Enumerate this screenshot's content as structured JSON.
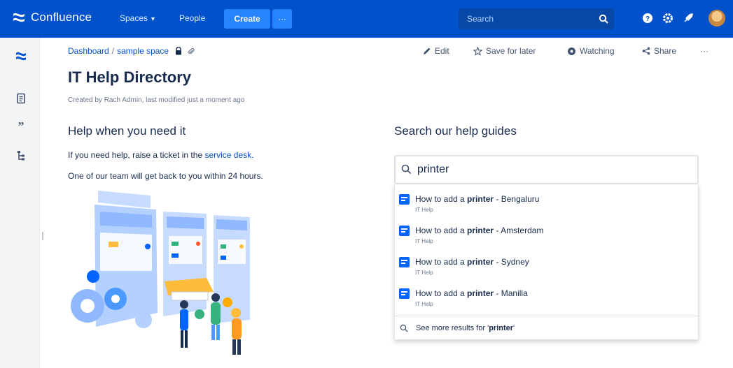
{
  "topnav": {
    "brand": "Confluence",
    "spaces_label": "Spaces",
    "people_label": "People",
    "create_label": "Create",
    "more_label": "···",
    "search_placeholder": "Search",
    "colors": {
      "bar": "#0052cc",
      "create": "#2684ff",
      "search": "#0747a6"
    }
  },
  "breadcrumb": {
    "dashboard": "Dashboard",
    "separator": "/",
    "space": "sample space"
  },
  "page_actions": {
    "edit": "Edit",
    "save_for_later": "Save for later",
    "watching": "Watching",
    "share": "Share",
    "more": "···"
  },
  "page": {
    "title": "IT Help Directory",
    "byline": "Created by Rach Admin, last modified just a moment ago"
  },
  "left_column": {
    "heading": "Help when you need it",
    "para1_prefix": "If you need help, raise a ticket in the ",
    "para1_link": "service desk",
    "para1_suffix": ".",
    "para2": "One of our team will get back to you within 24 hours."
  },
  "right_column": {
    "heading": "Search our help guides",
    "search_query": "printer",
    "results": [
      {
        "prefix": "How to add a ",
        "bold": "printer",
        "suffix": " - Bengaluru",
        "space": "IT Help"
      },
      {
        "prefix": "How to add a ",
        "bold": "printer",
        "suffix": " - Amsterdam",
        "space": "IT Help"
      },
      {
        "prefix": "How to add a ",
        "bold": "printer",
        "suffix": " - Sydney",
        "space": "IT Help"
      },
      {
        "prefix": "How to add a ",
        "bold": "printer",
        "suffix": " - Manilla",
        "space": "IT Help"
      }
    ],
    "see_more_prefix": "See more results for '",
    "see_more_term": "printer",
    "see_more_suffix": "'"
  },
  "icons": {
    "sidebar": [
      "confluence-logo-icon",
      "pages-icon",
      "blog-quote-icon",
      "page-tree-icon"
    ],
    "topnav_right": [
      "help-icon",
      "settings-icon",
      "notifications-icon"
    ],
    "result": "page-document-icon"
  }
}
